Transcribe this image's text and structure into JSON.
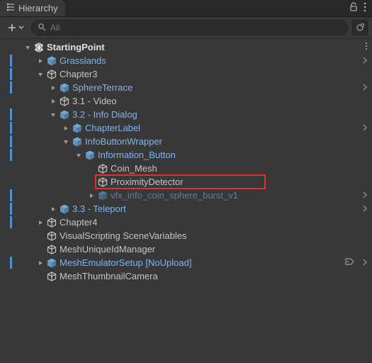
{
  "tab": {
    "title": "Hierarchy"
  },
  "toolbar": {
    "search_placeholder": "All"
  },
  "sceneName": "StartingPoint",
  "tree": [
    {
      "id": 0,
      "depth": 0,
      "label": "StartingPoint",
      "kind": "scene",
      "toggle": "open",
      "kebab": true
    },
    {
      "id": 1,
      "depth": 1,
      "label": "Grasslands",
      "kind": "prefab",
      "toggle": "closed",
      "bar": true,
      "chev": true
    },
    {
      "id": 2,
      "depth": 1,
      "label": "Chapter3",
      "kind": "nonprefab",
      "toggle": "open",
      "bar": true
    },
    {
      "id": 3,
      "depth": 2,
      "label": "SphereTerrace",
      "kind": "prefab",
      "toggle": "closed",
      "bar": true,
      "chev": true
    },
    {
      "id": 4,
      "depth": 2,
      "label": "3.1 - Video",
      "kind": "nonprefab",
      "toggle": "closed"
    },
    {
      "id": 5,
      "depth": 2,
      "label": "3.2 - Info Dialog",
      "kind": "prefab",
      "toggle": "open",
      "bar": true
    },
    {
      "id": 6,
      "depth": 3,
      "label": "ChapterLabel",
      "kind": "prefab",
      "toggle": "closed",
      "bar": true,
      "chev": true
    },
    {
      "id": 7,
      "depth": 3,
      "label": "InfoButtonWrapper",
      "kind": "prefab",
      "toggle": "open",
      "bar": true
    },
    {
      "id": 8,
      "depth": 4,
      "label": "Information_Button",
      "kind": "prefab",
      "toggle": "open",
      "bar": true
    },
    {
      "id": 9,
      "depth": 5,
      "label": "Coin_Mesh",
      "kind": "nonprefab",
      "toggle": "none"
    },
    {
      "id": 10,
      "depth": 5,
      "label": "ProximityDetector",
      "kind": "nonprefab",
      "toggle": "none",
      "highlight": true
    },
    {
      "id": 11,
      "depth": 5,
      "label": "vfx_info_coin_sphere_burst_v1",
      "kind": "prefab",
      "toggle": "closed",
      "bar": true,
      "chev": true,
      "dim": true
    },
    {
      "id": 12,
      "depth": 2,
      "label": "3.3 - Teleport",
      "kind": "prefab",
      "toggle": "closed",
      "bar": true,
      "chev": true
    },
    {
      "id": 13,
      "depth": 1,
      "label": "Chapter4",
      "kind": "nonprefab",
      "toggle": "closed",
      "bar": true
    },
    {
      "id": 14,
      "depth": 1,
      "label": "VisualScripting SceneVariables",
      "kind": "nonprefab",
      "toggle": "none"
    },
    {
      "id": 15,
      "depth": 1,
      "label": "MeshUniqueIdManager",
      "kind": "nonprefab",
      "toggle": "none"
    },
    {
      "id": 16,
      "depth": 1,
      "label": "MeshEmulatorSetup [NoUpload]",
      "kind": "prefab",
      "toggle": "closed",
      "bar": true,
      "chev": true,
      "tag": true
    },
    {
      "id": 17,
      "depth": 1,
      "label": "MeshThumbnailCamera",
      "kind": "nonprefab",
      "toggle": "none"
    }
  ]
}
